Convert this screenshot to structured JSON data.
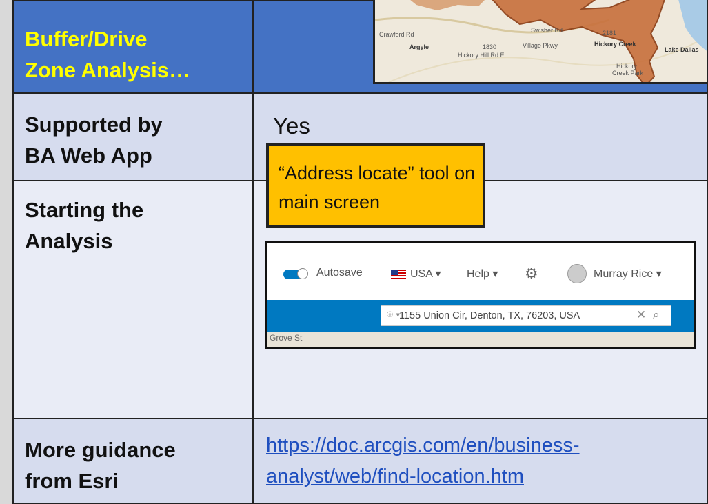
{
  "header": {
    "title_line1": "Buffer/Drive",
    "title_line2": "Zone Analysis…"
  },
  "rows": {
    "supported": {
      "label_line1": "Supported by",
      "label_line2": "BA Web App",
      "value": "Yes"
    },
    "starting": {
      "label_line1": "Starting the",
      "label_line2": "Analysis"
    },
    "guidance": {
      "label_line1": "More guidance",
      "label_line2": "from Esri",
      "link_line1": "https://doc.arcgis.com/en/business-",
      "link_line2": "analyst/web/find-location.htm"
    }
  },
  "callout": {
    "line1": "“Address locate” tool on",
    "line2": "main screen"
  },
  "map_thumb": {
    "labels": [
      "Crawford Rd",
      "Argyle",
      "Hickory Hill Rd E",
      "Swisher Rd",
      "Village Pkwy",
      "2181",
      "1830",
      "Hickory Creek",
      "Lake Dallas",
      "Hickory",
      "Creek Park"
    ]
  },
  "app": {
    "autosave": "Autosave",
    "country": "USA ▾",
    "help": "Help ▾",
    "user": "Murray Rice ▾",
    "search_pin": "⌾ ▾",
    "search_value": "1155 Union Cir, Denton, TX, 76203, USA",
    "clear": "✕",
    "search_icon": "⌕",
    "gear": "⚙",
    "map_street": "Grove St"
  },
  "colors": {
    "header_blue": "#4472c4",
    "header_text": "#ffff00",
    "callout": "#ffc000",
    "app_blue": "#0079c1",
    "link": "#1f4fbf"
  }
}
